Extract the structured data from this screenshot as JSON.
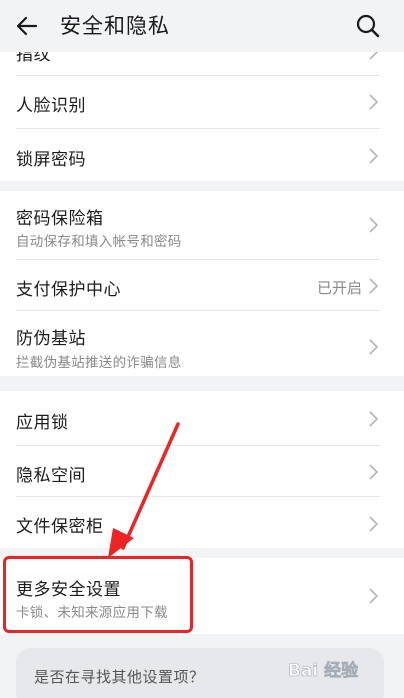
{
  "header": {
    "title": "安全和隐私",
    "back_icon": "back-arrow-icon",
    "search_icon": "search-icon"
  },
  "group1": {
    "items": [
      {
        "label": "指纹"
      },
      {
        "label": "人脸识别"
      },
      {
        "label": "锁屏密码"
      }
    ]
  },
  "group2": {
    "items": [
      {
        "label": "密码保险箱",
        "sub": "自动保存和填入帐号和密码"
      },
      {
        "label": "支付保护中心",
        "value": "已开启"
      },
      {
        "label": "防伪基站",
        "sub": "拦截伪基站推送的诈骗信息"
      }
    ]
  },
  "group3": {
    "items": [
      {
        "label": "应用锁"
      },
      {
        "label": "隐私空间"
      },
      {
        "label": "文件保密柜"
      }
    ]
  },
  "group4": {
    "items": [
      {
        "label": "更多安全设置",
        "sub": "卡锁、未知来源应用下载"
      }
    ]
  },
  "search_card": {
    "question": "是否在寻找其他设置项？"
  },
  "watermark": {
    "text": "Bai 经验"
  },
  "colors": {
    "annotation_red": "#ee2424",
    "background": "#f1f3f5",
    "card": "#ffffff",
    "secondary_text": "#8a8a8a"
  }
}
